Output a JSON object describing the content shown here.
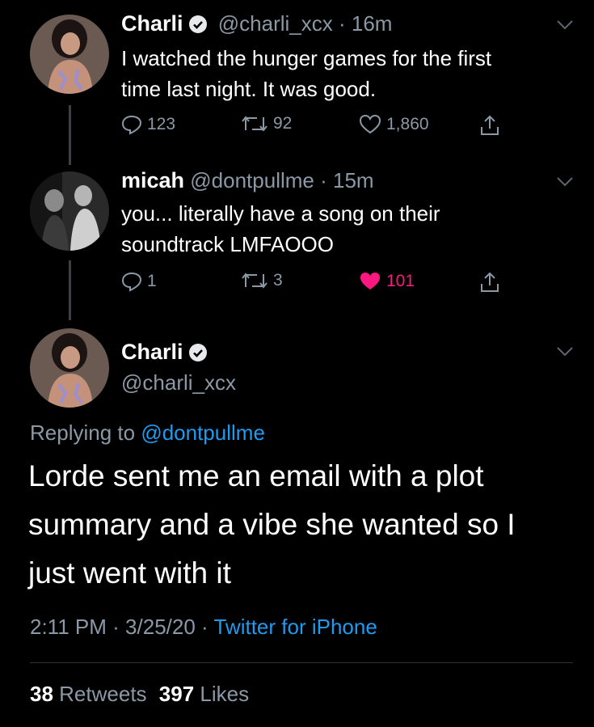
{
  "tweet1": {
    "name": "Charli",
    "handle": "@charli_xcx",
    "sep": "·",
    "time": "16m",
    "text_line1": "I watched the hunger games for the first",
    "text_line2": "time last night. It was good.",
    "replies": "123",
    "retweets": "92",
    "likes": "1,860"
  },
  "tweet2": {
    "name": "micah",
    "handle": "@dontpullme",
    "sep": "·",
    "time": "15m",
    "text_line1": "you... literally have a song on their",
    "text_line2": "soundtrack LMFAOOO",
    "replies": "1",
    "retweets": "3",
    "likes": "101",
    "like_color": "#f91880"
  },
  "main_tweet": {
    "name": "Charli",
    "handle": "@charli_xcx",
    "replying_prefix": "Replying to",
    "replying_handle": "@dontpullme",
    "text_line1": "Lorde sent me an email with a plot",
    "text_line2": "summary and a vibe she wanted so I",
    "text_line3": "just went with it",
    "time": "2:11 PM",
    "date": "3/25/20",
    "sep": "·",
    "source": "Twitter for iPhone",
    "retweets_count": "38",
    "retweets_label": "Retweets",
    "likes_count": "397",
    "likes_label": "Likes"
  },
  "icons": [
    "reply-icon",
    "retweet-icon",
    "heart-icon",
    "share-icon",
    "verified-icon",
    "chevron-down-icon"
  ],
  "colors": {
    "background": "#000000",
    "accent": "#1d9bf0",
    "like": "#f91880",
    "muted": "#8b98a5"
  }
}
